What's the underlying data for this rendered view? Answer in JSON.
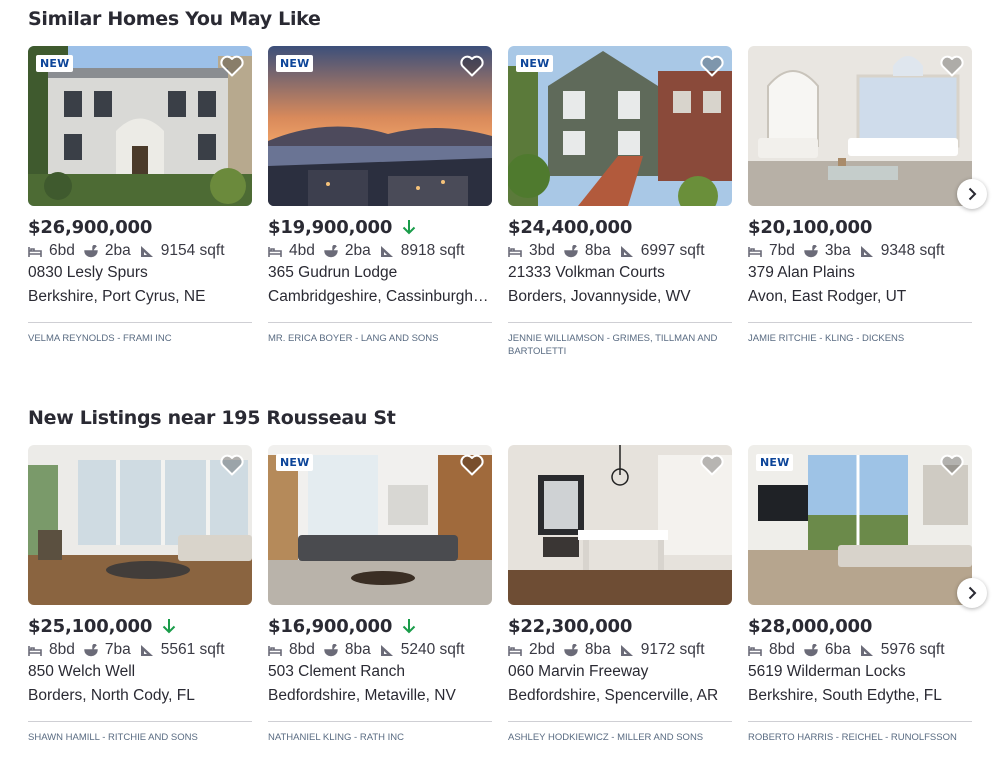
{
  "sections": [
    {
      "title": "Similar Homes You May Like",
      "cards": [
        {
          "badge": "NEW",
          "price": "$26,900,000",
          "price_drop": false,
          "beds": "6bd",
          "baths": "2ba",
          "sqft": "9154 sqft",
          "address_line1": "0830 Lesly Spurs",
          "address_line2": "Berkshire, Port Cyrus, NE",
          "agent": "VELMA REYNOLDS - FRAMI INC"
        },
        {
          "badge": "NEW",
          "price": "$19,900,000",
          "price_drop": true,
          "beds": "4bd",
          "baths": "2ba",
          "sqft": "8918 sqft",
          "address_line1": "365 Gudrun Lodge",
          "address_line2": "Cambridgeshire, Cassinburgh, OH",
          "agent": "MR. ERICA BOYER - LANG AND SONS"
        },
        {
          "badge": "NEW",
          "price": "$24,400,000",
          "price_drop": false,
          "beds": "3bd",
          "baths": "8ba",
          "sqft": "6997 sqft",
          "address_line1": "21333 Volkman Courts",
          "address_line2": "Borders, Jovannyside, WV",
          "agent": "JENNIE WILLIAMSON - GRIMES, TILLMAN AND BARTOLETTI"
        },
        {
          "badge": "",
          "price": "$20,100,000",
          "price_drop": false,
          "beds": "7bd",
          "baths": "3ba",
          "sqft": "9348 sqft",
          "address_line1": "379 Alan Plains",
          "address_line2": "Avon, East Rodger, UT",
          "agent": "JAMIE RITCHIE - KLING - DICKENS"
        }
      ]
    },
    {
      "title": "New Listings near 195 Rousseau St",
      "cards": [
        {
          "badge": "",
          "price": "$25,100,000",
          "price_drop": true,
          "beds": "8bd",
          "baths": "7ba",
          "sqft": "5561 sqft",
          "address_line1": "850 Welch Well",
          "address_line2": "Borders, North Cody, FL",
          "agent": "SHAWN HAMILL - RITCHIE AND SONS"
        },
        {
          "badge": "NEW",
          "price": "$16,900,000",
          "price_drop": true,
          "beds": "8bd",
          "baths": "8ba",
          "sqft": "5240 sqft",
          "address_line1": "503 Clement Ranch",
          "address_line2": "Bedfordshire, Metaville, NV",
          "agent": "NATHANIEL KLING - RATH INC"
        },
        {
          "badge": "",
          "price": "$22,300,000",
          "price_drop": false,
          "beds": "2bd",
          "baths": "8ba",
          "sqft": "9172 sqft",
          "address_line1": "060 Marvin Freeway",
          "address_line2": "Bedfordshire, Spencerville, AR",
          "agent": "ASHLEY HODKIEWICZ - MILLER AND SONS"
        },
        {
          "badge": "NEW",
          "price": "$28,000,000",
          "price_drop": false,
          "beds": "8bd",
          "baths": "6ba",
          "sqft": "5976 sqft",
          "address_line1": "5619 Wilderman Locks",
          "address_line2": "Berkshire, South Edythe, FL",
          "agent": "ROBERTO HARRIS - REICHEL - RUNOLFSSON"
        }
      ]
    }
  ],
  "colors": {
    "badge_text": "#0d4599",
    "price_drop_arrow": "#1a9c4a",
    "agent_text": "#596b82",
    "divider": "#cfcfd4"
  },
  "icons": {
    "favorite": "heart-icon",
    "beds": "bed-icon",
    "baths": "bath-icon",
    "sqft": "ruler-icon",
    "price_drop": "arrow-down-icon",
    "next": "chevron-right-icon"
  }
}
